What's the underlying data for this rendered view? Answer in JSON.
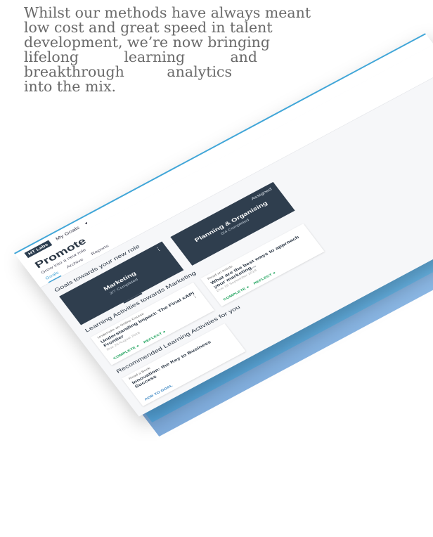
{
  "intro": {
    "lines": [
      "Whilst our methods have always meant",
      "low cost and great speed in talent",
      "development, we’re now bringing",
      "lifelong learning and",
      "breakthrough analytics",
      "into the mix."
    ]
  },
  "app": {
    "logo": "HT Labs",
    "menu_label": "My Goals",
    "page_title": "Promote",
    "page_subtitle": "Grow into a new role",
    "tabs": [
      "Goals",
      "Archive",
      "Reports"
    ],
    "goals_section": "Goals towards your new role",
    "goal_cards": [
      {
        "name": "Marketing",
        "count": "2/7 Completed",
        "status": ""
      },
      {
        "name": "Planning & Organising",
        "count": "0/4 Completed",
        "status": "Assigned"
      }
    ],
    "activities_section": "Learning Activities towards Marketing",
    "activities": [
      {
        "kind": "Undertake an Online Course",
        "title": "Understanding Impact: The Final xAPI Frontier",
        "date": "Due 26 August 2018",
        "complete": "COMPLETE",
        "reflect": "REFLECT"
      },
      {
        "kind": "Read an Article",
        "title": "What are the best ways to approach your marketing...",
        "date": "Due 18 September 2018",
        "complete": "COMPLETE",
        "reflect": "REFLECT"
      }
    ],
    "recommended_section": "Recommended Learning Activities for you",
    "recommended": [
      {
        "kind": "Read a Book",
        "title": "Innovation: the Key to Business Success",
        "action": "ADD TO GOAL"
      }
    ]
  },
  "colors": {
    "accent": "#3aa0d5",
    "card_dark": "#2f3e4e",
    "complete_green": "#1aa15a",
    "layer_blue": "#4aa6dd"
  }
}
